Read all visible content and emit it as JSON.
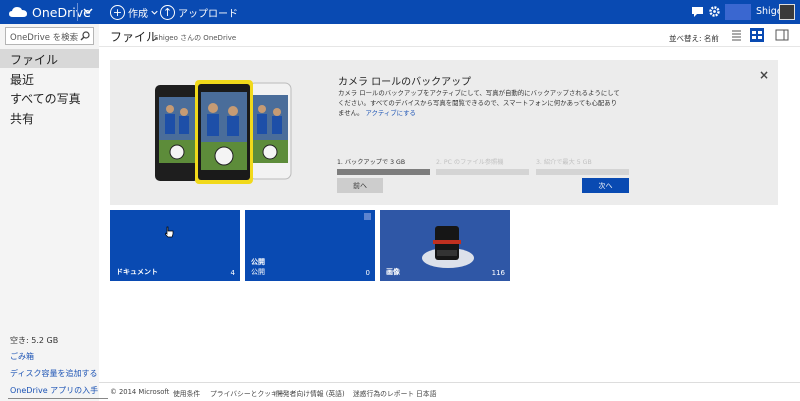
{
  "topbar": {
    "logo": "OneDrive",
    "create": "作成",
    "upload": "アップロード",
    "user": "Shigeo",
    "colors": {
      "bar": "#094ab2"
    }
  },
  "sidebar": {
    "search_placeholder": "OneDrive を検索",
    "items": [
      {
        "label": "ファイル",
        "active": true
      },
      {
        "label": "最近"
      },
      {
        "label": "すべての写真"
      },
      {
        "label": "共有"
      }
    ],
    "free_space": "空き: 5.2 GB",
    "links": [
      "ごみ箱",
      "ディスク容量を追加する",
      "OneDrive アプリの入手"
    ]
  },
  "header": {
    "title": "ファイル",
    "subtitle": "Shigeo さんの OneDrive",
    "sort": "並べ替え: 名前"
  },
  "promo": {
    "title": "カメラ ロールのバックアップ",
    "body": "カメラ ロールのバックアップをアクティブにして、写真が自動的にバックアップされるようにしてください。すべてのデバイスから写真を閲覧できるので、スマートフォンに何かあっても心配ありません。",
    "link": "アクティブにする",
    "steps": [
      {
        "label": "1. バックアップで 3 GB",
        "progress": 1.0
      },
      {
        "label": "2. PC のファイル参照機",
        "progress": 0
      },
      {
        "label": "3. 紹介で最大 5 GB",
        "progress": 0
      }
    ],
    "prev": "前へ",
    "next": "次へ"
  },
  "tiles": [
    {
      "name": "ドキュメント",
      "count": "4"
    },
    {
      "name": "公開",
      "sub": "公開",
      "count": "0"
    },
    {
      "name": "画像",
      "count": "116"
    }
  ],
  "footer": [
    "© 2014 Microsoft",
    "使用条件",
    "プライバシーとクッキー",
    "開発者向け情報 (英語)",
    "迷惑行為のレポート",
    "日本語"
  ]
}
